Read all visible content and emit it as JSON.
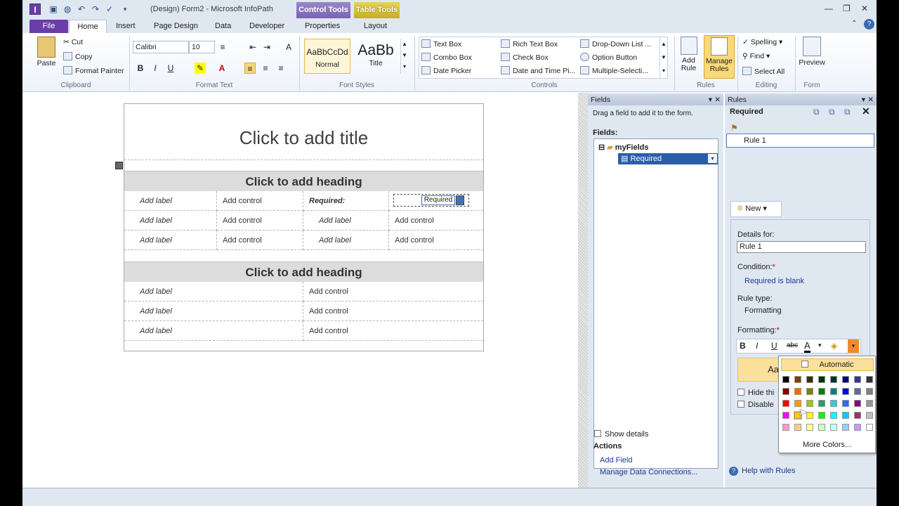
{
  "window": {
    "title": "(Design) Form2 - Microsoft InfoPath",
    "context_control": "Control Tools",
    "context_table": "Table Tools"
  },
  "tabs": [
    "File",
    "Home",
    "Insert",
    "Page Design",
    "Data",
    "Developer",
    "Properties",
    "Layout"
  ],
  "ribbon": {
    "clipboard": {
      "paste": "Paste",
      "cut": "Cut",
      "copy": "Copy",
      "format_painter": "Format Painter",
      "label": "Clipboard"
    },
    "format_text": {
      "font": "Calibri",
      "size": "10",
      "label": "Format Text",
      "bold": "B",
      "italic": "I",
      "underline": "U"
    },
    "font_styles": {
      "normal_sample": "AaBbCcDd",
      "normal": "Normal",
      "title_sample": "AaBb",
      "title": "Title",
      "label": "Font Styles"
    },
    "controls": {
      "items": [
        "Text Box",
        "Combo Box",
        "Date Picker",
        "Rich Text Box",
        "Check Box",
        "Date and Time Pi...",
        "Drop-Down List ...",
        "Option Button",
        "Multiple-Selecti..."
      ],
      "label": "Controls"
    },
    "rules": {
      "add_rule": "Add Rule",
      "manage_rules": "Manage Rules",
      "label": "Rules"
    },
    "editing": {
      "spelling": "Spelling",
      "find": "Find",
      "select_all": "Select All",
      "label": "Editing"
    },
    "form": {
      "preview": "Preview",
      "label": "Form"
    }
  },
  "form": {
    "title": "Click to add title",
    "heading1": "Click to add heading",
    "heading2": "Click to add heading",
    "add_label": "Add label",
    "add_control": "Add control",
    "required_label": "Required:",
    "required_control": "Required"
  },
  "fields_pane": {
    "title": "Fields",
    "hint": "Drag a field to add it to the form.",
    "fields_label": "Fields:",
    "root": "myFields",
    "field": "Required",
    "show_details": "Show details",
    "actions": "Actions",
    "add_field": "Add Field",
    "manage_data": "Manage Data Connections..."
  },
  "rules_pane": {
    "title": "Rules",
    "subject": "Required",
    "rule_item": "Rule 1",
    "new": "New",
    "details_for": "Details for:",
    "rule_name": "Rule 1",
    "condition": "Condition:",
    "condition_value": "Required is blank",
    "rule_type": "Rule type:",
    "rule_type_value": "Formatting",
    "formatting": "Formatting:",
    "hide": "Hide thi",
    "disable": "Disable",
    "help": "Help with Rules",
    "sample": "Aa"
  },
  "color_picker": {
    "automatic": "Automatic",
    "more": "More Colors...",
    "rows": [
      [
        "#000000",
        "#7f3f00",
        "#333300",
        "#003300",
        "#003333",
        "#000080",
        "#333399",
        "#333333"
      ],
      [
        "#800000",
        "#ff6600",
        "#808000",
        "#008000",
        "#008080",
        "#0000ff",
        "#666699",
        "#808080"
      ],
      [
        "#ff0000",
        "#ff9900",
        "#99cc00",
        "#339966",
        "#33cccc",
        "#3366ff",
        "#800080",
        "#969696"
      ],
      [
        "#ff00ff",
        "#ffcc00",
        "#ffff00",
        "#00ff00",
        "#00ffff",
        "#00ccff",
        "#993366",
        "#c0c0c0"
      ],
      [
        "#ff99cc",
        "#ffcc99",
        "#ffff99",
        "#ccffcc",
        "#ccffff",
        "#99ccff",
        "#cc99ff",
        "#ffffff"
      ]
    ]
  }
}
